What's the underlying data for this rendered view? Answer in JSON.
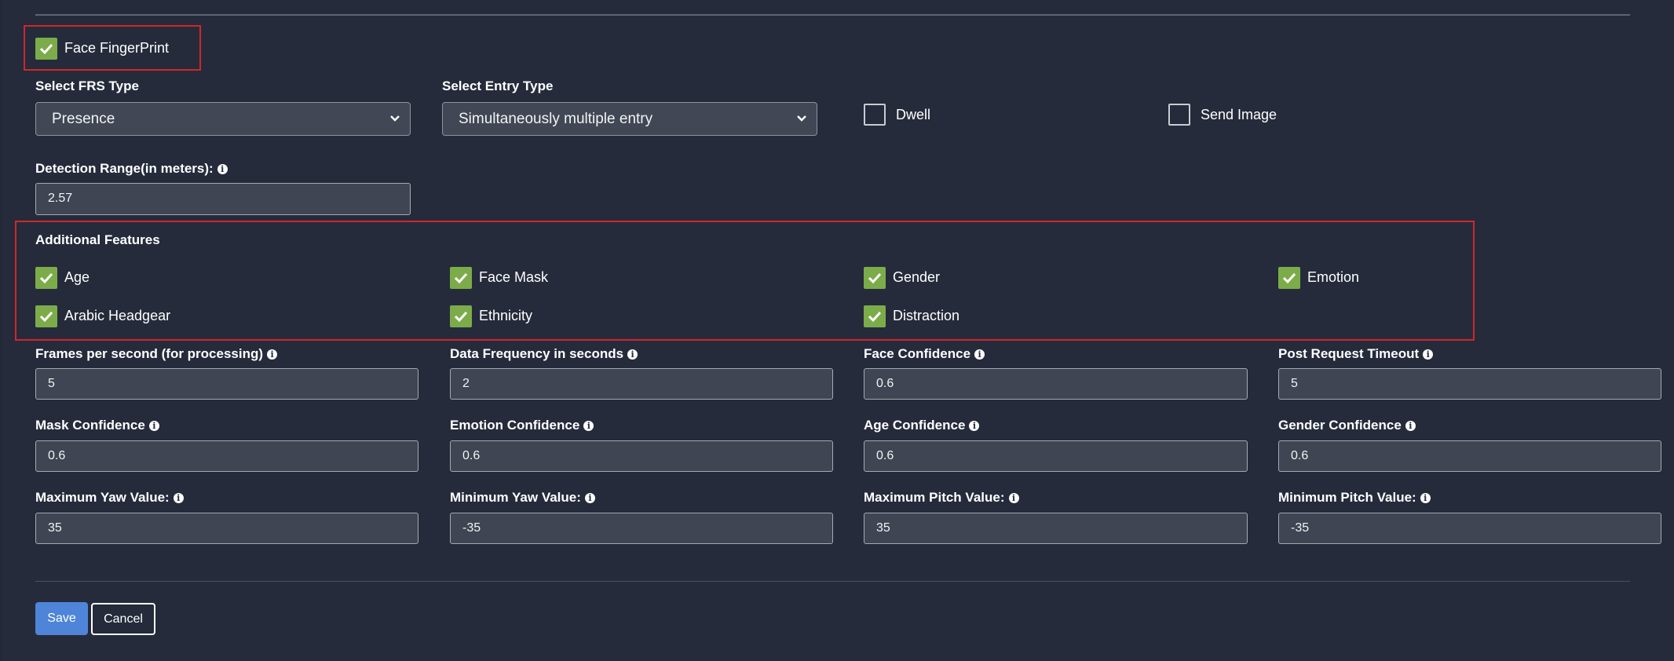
{
  "face_fingerprint": {
    "label": "Face FingerPrint",
    "checked": true
  },
  "frs_type": {
    "label": "Select FRS Type",
    "value": "Presence"
  },
  "entry_type": {
    "label": "Select Entry Type",
    "value": "Simultaneously multiple entry"
  },
  "dwell": {
    "label": "Dwell",
    "checked": false
  },
  "send_image": {
    "label": "Send Image",
    "checked": false
  },
  "detection_range": {
    "label": "Detection Range(in meters):",
    "value": "2.57"
  },
  "additional_features": {
    "title": "Additional Features",
    "items": [
      {
        "label": "Age",
        "checked": true
      },
      {
        "label": "Face Mask",
        "checked": true
      },
      {
        "label": "Gender",
        "checked": true
      },
      {
        "label": "Emotion",
        "checked": true
      },
      {
        "label": "Arabic Headgear",
        "checked": true
      },
      {
        "label": "Ethnicity",
        "checked": true
      },
      {
        "label": "Distraction",
        "checked": true
      }
    ]
  },
  "fields": [
    {
      "label": "Frames per second (for processing)",
      "value": "5"
    },
    {
      "label": "Data Frequency in seconds",
      "value": "2"
    },
    {
      "label": "Face Confidence",
      "value": "0.6"
    },
    {
      "label": "Post Request Timeout",
      "value": "5"
    },
    {
      "label": "Mask Confidence",
      "value": "0.6"
    },
    {
      "label": "Emotion Confidence",
      "value": "0.6"
    },
    {
      "label": "Age Confidence",
      "value": "0.6"
    },
    {
      "label": "Gender Confidence",
      "value": "0.6"
    },
    {
      "label": "Maximum Yaw Value:",
      "value": "35"
    },
    {
      "label": "Minimum Yaw Value:",
      "value": "-35"
    },
    {
      "label": "Maximum Pitch Value:",
      "value": "35"
    },
    {
      "label": "Minimum Pitch Value:",
      "value": "-35"
    }
  ],
  "info_icon_glyph": "i",
  "actions": {
    "save_label": "Save",
    "cancel_label": "Cancel"
  },
  "colors": {
    "background": "#252b3b",
    "checkbox_checked": "#7cac4a",
    "highlight_border": "#d0262b",
    "save_button": "#4f85d8"
  }
}
